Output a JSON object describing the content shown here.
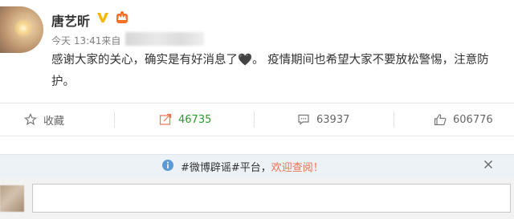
{
  "post": {
    "author": "唐艺昕",
    "time": "今天 13:41",
    "source_prefix": "来自",
    "content": "感谢大家的关心，确实是有好消息了",
    "content_tail": "。 疫情期间也希望大家不要放松警惕，注意防护。",
    "heart": "🖤"
  },
  "actions": {
    "favorite_label": "收藏",
    "forward_count": "46735",
    "comment_count": "63937",
    "like_count": "606776"
  },
  "notice": {
    "text_prefix": "#微博辟谣#平台，",
    "link_text": "欢迎查阅！"
  },
  "colors": {
    "accent_orange": "#eb7350",
    "forward_green": "#2c9a2c",
    "verified_yellow": "#f7b500"
  }
}
